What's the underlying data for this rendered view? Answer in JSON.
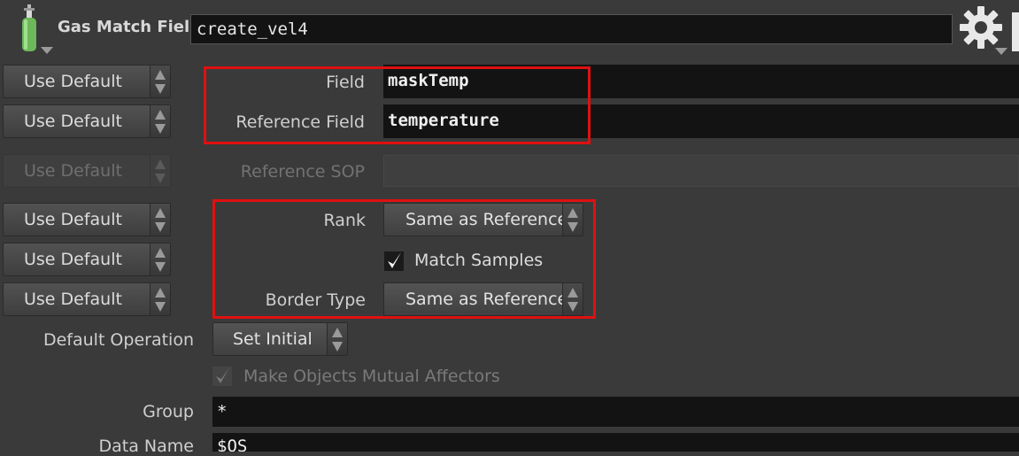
{
  "header": {
    "node_type_title": "Gas Match Field",
    "node_name": "create_vel4"
  },
  "use_default_label": "Use Default",
  "params": {
    "field": {
      "label": "Field",
      "value": "maskTemp"
    },
    "reference_field": {
      "label": "Reference Field",
      "value": "temperature"
    },
    "reference_sop": {
      "label": "Reference SOP",
      "value": ""
    },
    "rank": {
      "label": "Rank",
      "value": "Same as Reference"
    },
    "match_samples": {
      "label": "Match Samples",
      "checked": true
    },
    "border_type": {
      "label": "Border Type",
      "value": "Same as Reference"
    },
    "default_operation": {
      "label": "Default Operation",
      "value": "Set Initial"
    },
    "mutual_affectors": {
      "label": "Make Objects Mutual Affectors",
      "checked": true,
      "enabled": false
    },
    "group": {
      "label": "Group",
      "value": "*"
    },
    "data_name": {
      "label": "Data Name",
      "value": "$OS"
    }
  },
  "colors": {
    "highlight": "#e01010",
    "background": "#3a3a3a",
    "field_bg": "#131313"
  },
  "icons": [
    "gas-cylinder-icon",
    "gear-icon",
    "chevron-down-icon",
    "checkmark-icon"
  ]
}
